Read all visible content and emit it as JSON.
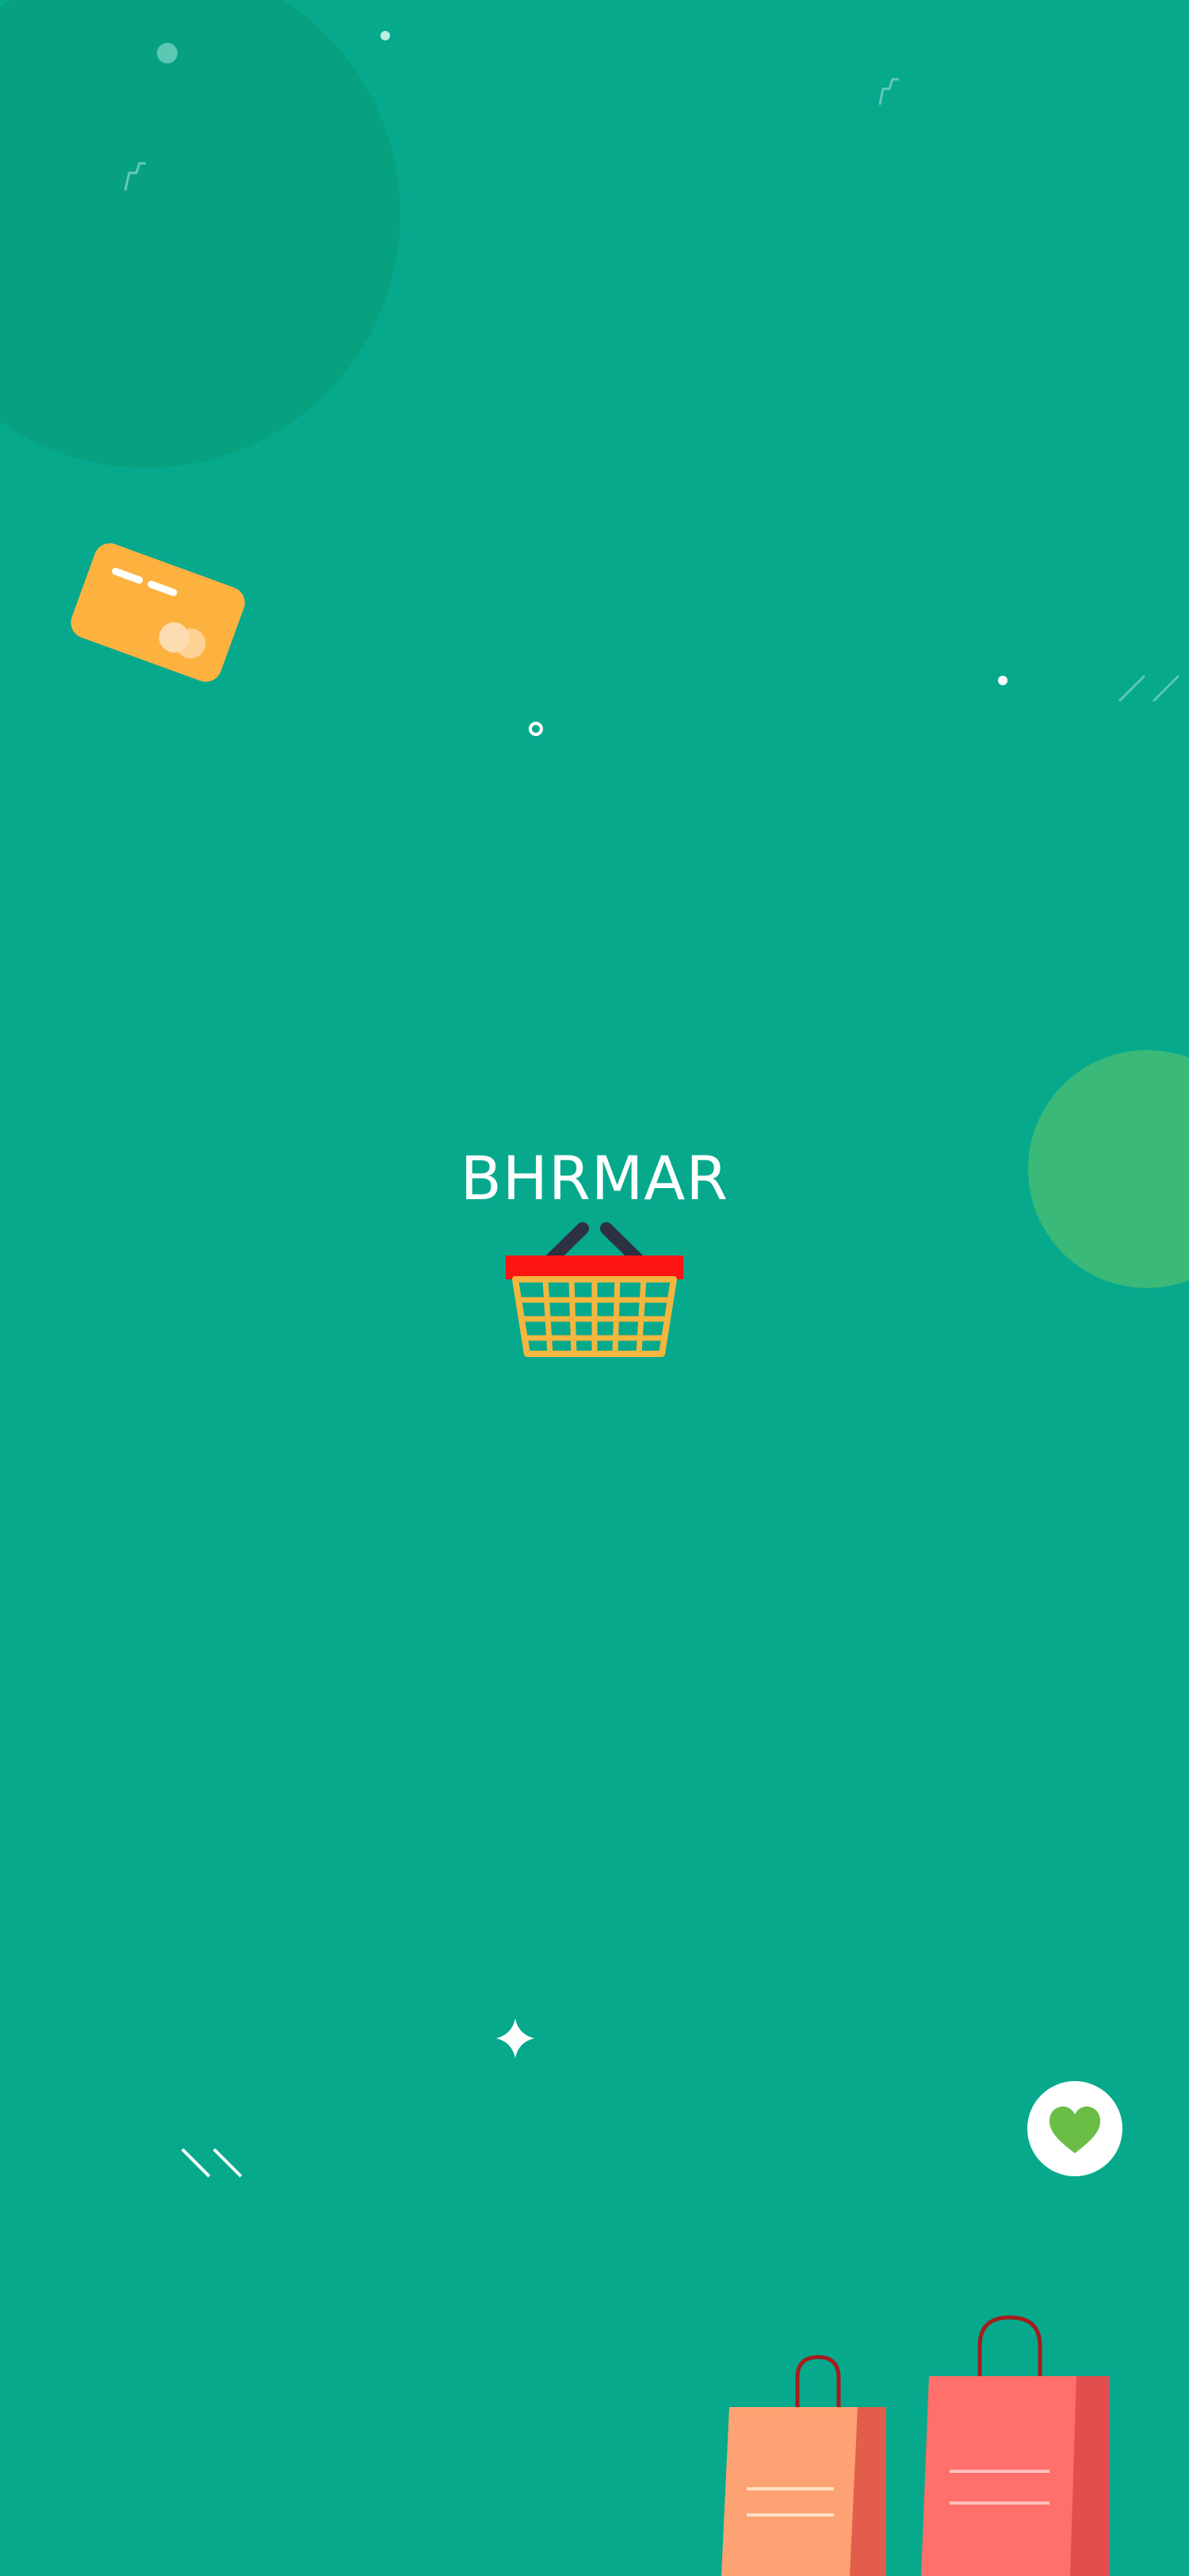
{
  "app": {
    "title": "BHRMAR"
  },
  "icons": [
    "shopping-basket-icon",
    "credit-card-icon",
    "heart-icon",
    "shopping-bag-icon",
    "sparkle-icon"
  ],
  "colors": {
    "background": "#07A98D",
    "title_text": "#FFFFFF",
    "basket_rim": "#FF1414",
    "basket_body": "#F4B63E",
    "basket_handle": "#2D3142",
    "card": "#FDB240",
    "heart": "#6BBE45",
    "bag_orange": "#FDA272",
    "bag_red": "#FF6F6C"
  }
}
